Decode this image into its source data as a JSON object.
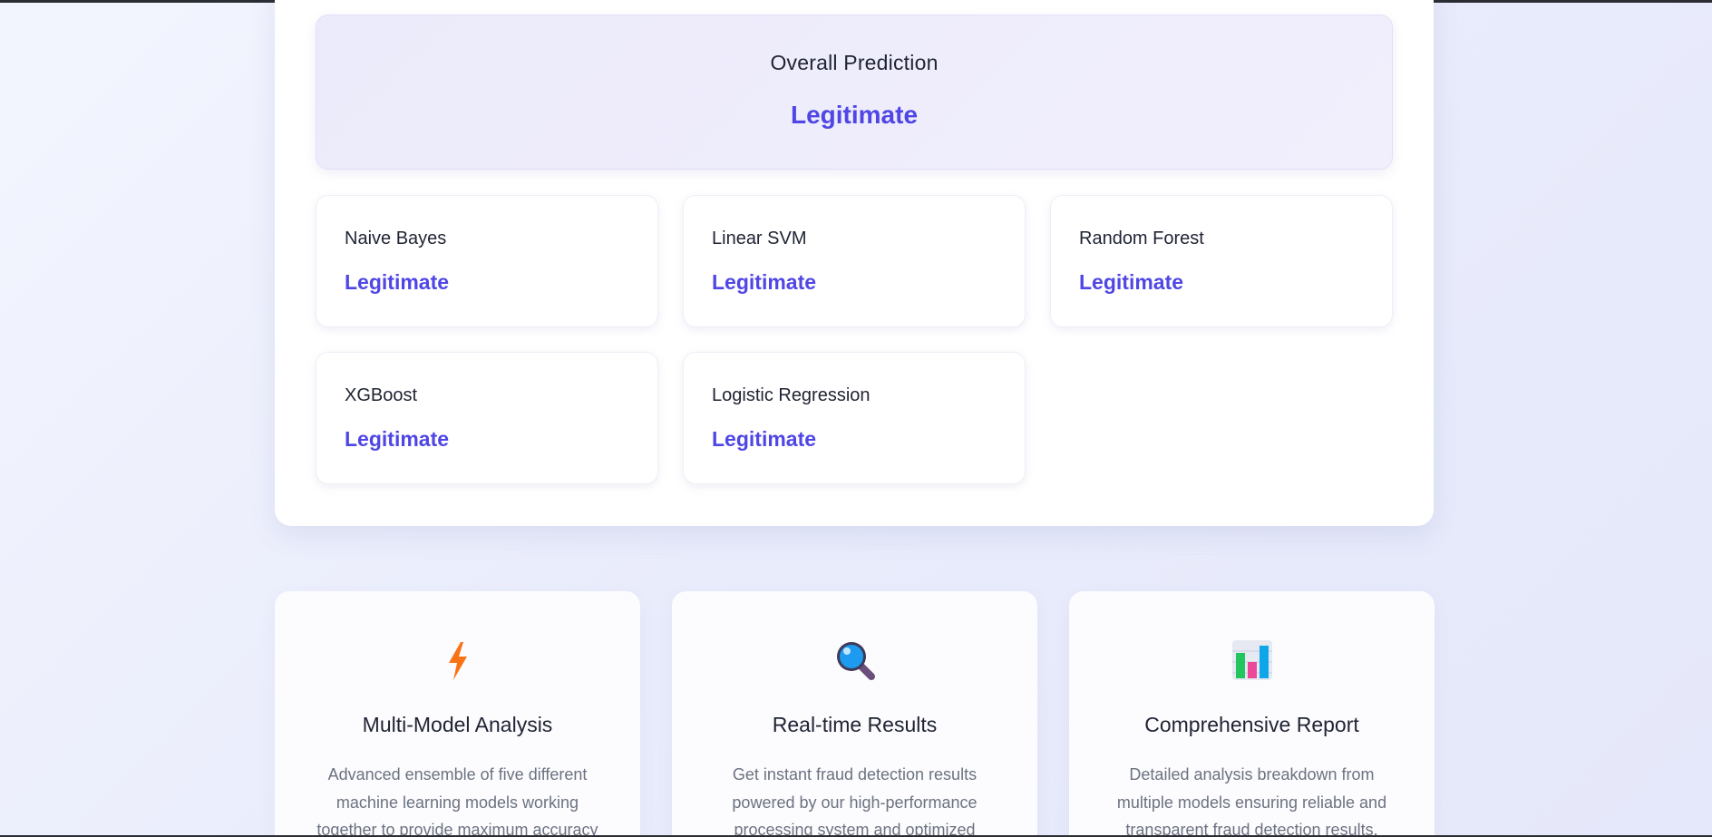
{
  "overall": {
    "title": "Overall Prediction",
    "value": "Legitimate"
  },
  "models": [
    {
      "name": "Naive Bayes",
      "value": "Legitimate"
    },
    {
      "name": "Linear SVM",
      "value": "Legitimate"
    },
    {
      "name": "Random Forest",
      "value": "Legitimate"
    },
    {
      "name": "XGBoost",
      "value": "Legitimate"
    },
    {
      "name": "Logistic Regression",
      "value": "Legitimate"
    }
  ],
  "features": [
    {
      "icon": "lightning-icon",
      "title": "Multi-Model Analysis",
      "description": "Advanced ensemble of five different machine learning models working together to provide maximum accuracy"
    },
    {
      "icon": "magnifying-glass-icon",
      "title": "Real-time Results",
      "description": "Get instant fraud detection results powered by our high-performance processing system and optimized"
    },
    {
      "icon": "bar-chart-icon",
      "title": "Comprehensive Report",
      "description": "Detailed analysis breakdown from multiple models ensuring reliable and transparent fraud detection results."
    }
  ],
  "colors": {
    "accent": "#4f46e5",
    "text": "#1f2333",
    "muted": "#6b7280"
  }
}
